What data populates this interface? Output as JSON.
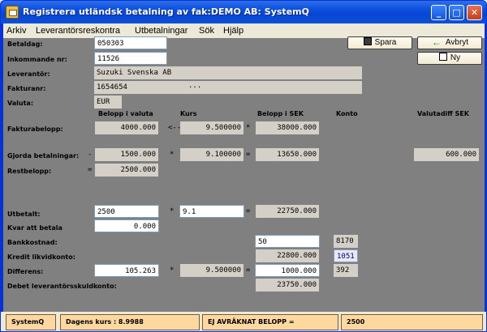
{
  "window": {
    "title": "Registrera utländsk betalning av fak:DEMO AB: SystemQ",
    "min_label": "_",
    "max_label": "□",
    "close_label": "✕"
  },
  "menu": [
    "Arkiv",
    "Leverantörsreskontra",
    "Utbetalningar",
    "Sök",
    "Hjälp"
  ],
  "buttons": {
    "spara": "Spara",
    "avbryt": "Avbryt",
    "ny": "Ny"
  },
  "form": {
    "betaldag_label": "Betaldag:",
    "betaldag": "050303",
    "inkommande_label": "Inkommande nr:",
    "inkommande": "11526",
    "leverantor_label": "Leverantör:",
    "leverantor": "Suzuki Svenska AB",
    "fakturanr_label": "Fakturanr:",
    "fakturanr": "1654654",
    "fakturanr_more": "...",
    "valuta_label": "Valuta:",
    "valuta": "EUR"
  },
  "headers": {
    "belopp_valuta": "Belopp i valuta",
    "kurs": "Kurs",
    "belopp_sek": "Belopp i SEK",
    "konto": "Konto",
    "valutadiff": "Valutadiff SEK"
  },
  "rows": {
    "fakturabelopp_label": "Fakturabelopp:",
    "fakturabelopp_valuta": "4000.000",
    "fakturabelopp_op": "<--",
    "fakturabelopp_kurs": "9.500000",
    "fakturabelopp_mul": "*",
    "fakturabelopp_sek": "38000.000",
    "gjorda_label": "Gjorda betalningar:",
    "gjorda_sign": "-",
    "gjorda_valuta": "1500.000",
    "gjorda_mul": "*",
    "gjorda_kurs": "9.100000",
    "gjorda_eq": "=",
    "gjorda_sek": "13650.000",
    "gjorda_diff": "600.000",
    "rest_label": "Restbelopp:",
    "rest_eq": "=",
    "rest_valuta": "2500.000",
    "utbetalt_label": "Utbetalt:",
    "utbetalt_valuta": "2500",
    "utbetalt_mul": "*",
    "utbetalt_kurs": "9.1",
    "utbetalt_eq": "=",
    "utbetalt_sek": "22750.000",
    "kvar_label": "Kvar att betala",
    "kvar_valuta": "0.000",
    "bankkostnad_label": "Bankkostnad:",
    "bankkostnad_sek": "50",
    "bankkostnad_konto": "8170",
    "kredit_label": "Kredit likvidkonto:",
    "kredit_sek": "22800.000",
    "kredit_konto": "1051",
    "differens_label": "Differens:",
    "differens_valuta": "105.263",
    "differens_mul": "*",
    "differens_kurs": "9.500000",
    "differens_eq": "=",
    "differens_sek": "1000.000",
    "differens_konto": "392",
    "debet_label": "Debet leverantörsskuldkonto:",
    "debet_sek": "23750.000"
  },
  "status": {
    "app": "SystemQ",
    "kurs": "Dagens kurs : 8.9988",
    "avraknat": "EJ AVRÄKNAT BELOPP =",
    "belopp": "2500"
  }
}
